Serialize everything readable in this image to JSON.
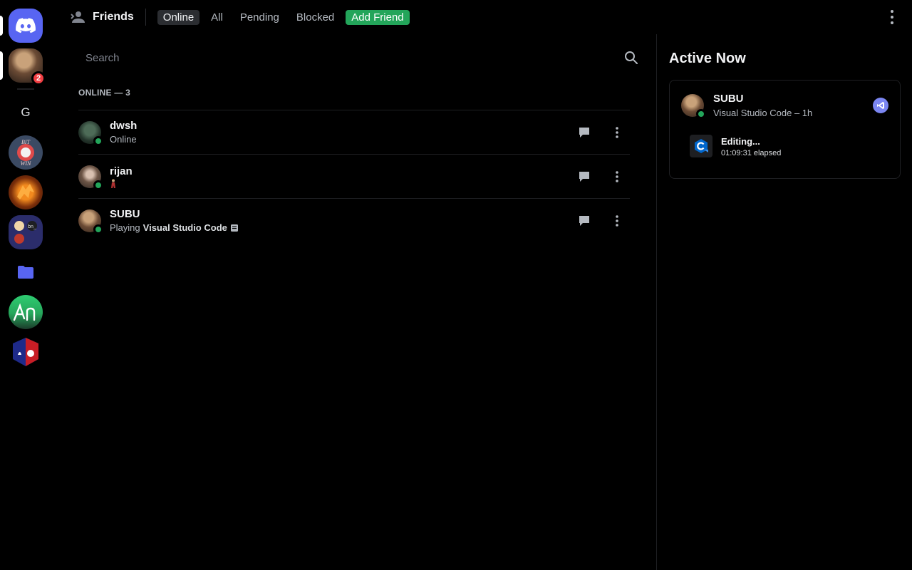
{
  "topbar": {
    "title": "Friends",
    "tabs": [
      {
        "label": "Online"
      },
      {
        "label": "All"
      },
      {
        "label": "Pending"
      },
      {
        "label": "Blocked"
      },
      {
        "label": "Add Friend"
      }
    ]
  },
  "rail": {
    "home_icon": "discord-logo-icon",
    "unread_badge": "2",
    "server_letter": "G",
    "server_badge_text": "BIT WIN"
  },
  "search": {
    "placeholder": "Search"
  },
  "section": {
    "label": "ONLINE — 3"
  },
  "friends": [
    {
      "name": "dwsh",
      "status": "Online"
    },
    {
      "name": "rijan",
      "status": ""
    },
    {
      "name": "SUBU",
      "status_prefix": "Playing",
      "status_app": "Visual Studio Code"
    }
  ],
  "active_now": {
    "title": "Active Now",
    "card": {
      "name": "SUBU",
      "subtitle": "Visual Studio Code – 1h",
      "activity_title": "Editing...",
      "activity_time": "01:09:31 elapsed"
    }
  },
  "colors": {
    "brand": "#5865f2",
    "online": "#23a55a",
    "add_friend": "#23a55a",
    "badge": "#f23f43"
  }
}
